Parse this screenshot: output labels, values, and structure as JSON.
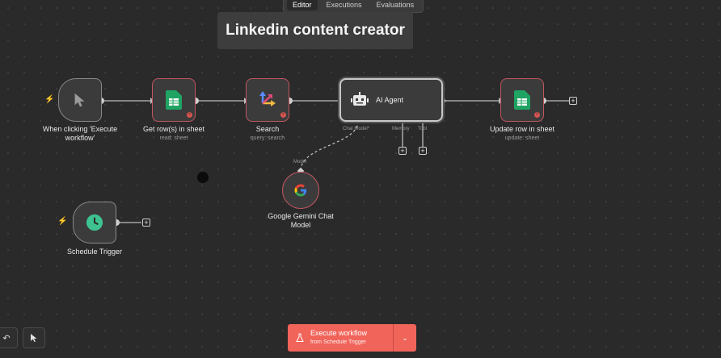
{
  "tabs": {
    "editor": "Editor",
    "executions": "Executions",
    "evaluations": "Evaluations"
  },
  "sticky": {
    "title": "Linkedin content creator"
  },
  "nodes": {
    "manual": {
      "label_line1": "When clicking 'Execute",
      "label_line2": "workflow'"
    },
    "get_rows": {
      "label": "Get row(s) in sheet",
      "sub": "read: sheet"
    },
    "search": {
      "label": "Search",
      "sub": "query: search"
    },
    "agent": {
      "title": "AI Agent",
      "port_chat": "Chat Model*",
      "port_memory": "Memory",
      "port_tool": "Tool"
    },
    "update": {
      "label": "Update row in sheet",
      "sub": "update: sheet"
    },
    "gemini": {
      "port": "Model",
      "label_line1": "Google Gemini Chat",
      "label_line2": "Model"
    },
    "schedule": {
      "label": "Schedule Trigger"
    }
  },
  "run_button": {
    "label": "Execute workflow",
    "sublabel": "from Schedule Trigger"
  },
  "colors": {
    "accent": "#f0645a",
    "sheets_green": "#1fa463",
    "error": "#d9534f",
    "schedule_green": "#3ec28f"
  },
  "icons": [
    "cursor-icon",
    "sheets-icon",
    "search-arrows-icon",
    "robot-icon",
    "google-g-icon",
    "clock-icon",
    "flask-icon",
    "undo-icon",
    "pointer-icon"
  ]
}
